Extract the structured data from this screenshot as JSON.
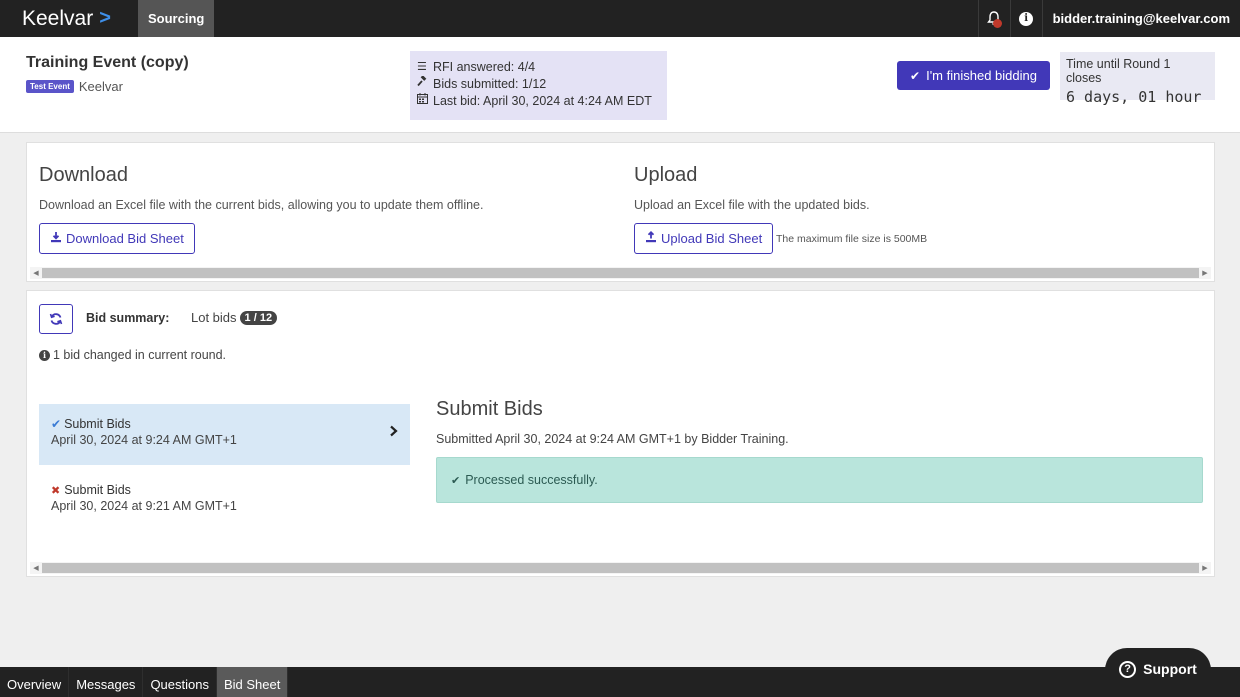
{
  "topbar": {
    "logo": "Keelvar",
    "logo_chevron": ">",
    "nav_active": "Sourcing",
    "user_email": "bidder.training@keelvar.com"
  },
  "event": {
    "title": "Training Event (copy)",
    "badge": "Test Event",
    "organization": "Keelvar",
    "stats": {
      "rfi": "RFI answered: 4/4",
      "bids": "Bids submitted: 1/12",
      "last_bid": "Last bid: April 30, 2024 at 4:24 AM EDT"
    },
    "finish_button": "I'm finished bidding",
    "timer_label": "Time until Round 1 closes",
    "timer_value": "6 days, 01 hour"
  },
  "download": {
    "title": "Download",
    "description": "Download an Excel file with the current bids, allowing you to update them offline.",
    "button": "Download Bid Sheet"
  },
  "upload": {
    "title": "Upload",
    "description": "Upload an Excel file with the updated bids.",
    "button": "Upload Bid Sheet",
    "size_note": "The maximum file size is 500MB"
  },
  "summary": {
    "label": "Bid summary:",
    "lot_bids_label": "Lot bids",
    "lot_bids_count": "1 / 12",
    "changed_note": "1 bid changed in current round.",
    "history": [
      {
        "title": "Submit Bids",
        "date": "April 30, 2024 at 9:24 AM GMT+1",
        "status": "success"
      },
      {
        "title": "Submit Bids",
        "date": "April 30, 2024 at 9:21 AM GMT+1",
        "status": "error"
      }
    ],
    "detail": {
      "title": "Submit Bids",
      "subtitle": "Submitted April 30, 2024 at 9:24 AM GMT+1 by Bidder Training.",
      "message": "Processed successfully."
    }
  },
  "bottom_tabs": [
    "Overview",
    "Messages",
    "Questions",
    "Bid Sheet"
  ],
  "bottom_tab_active": "Bid Sheet",
  "support": "Support",
  "colors": {
    "primary": "#4138b8",
    "topbar": "#222222",
    "success_bg": "#b9e5dc",
    "active_item_bg": "#d8e8f6"
  }
}
